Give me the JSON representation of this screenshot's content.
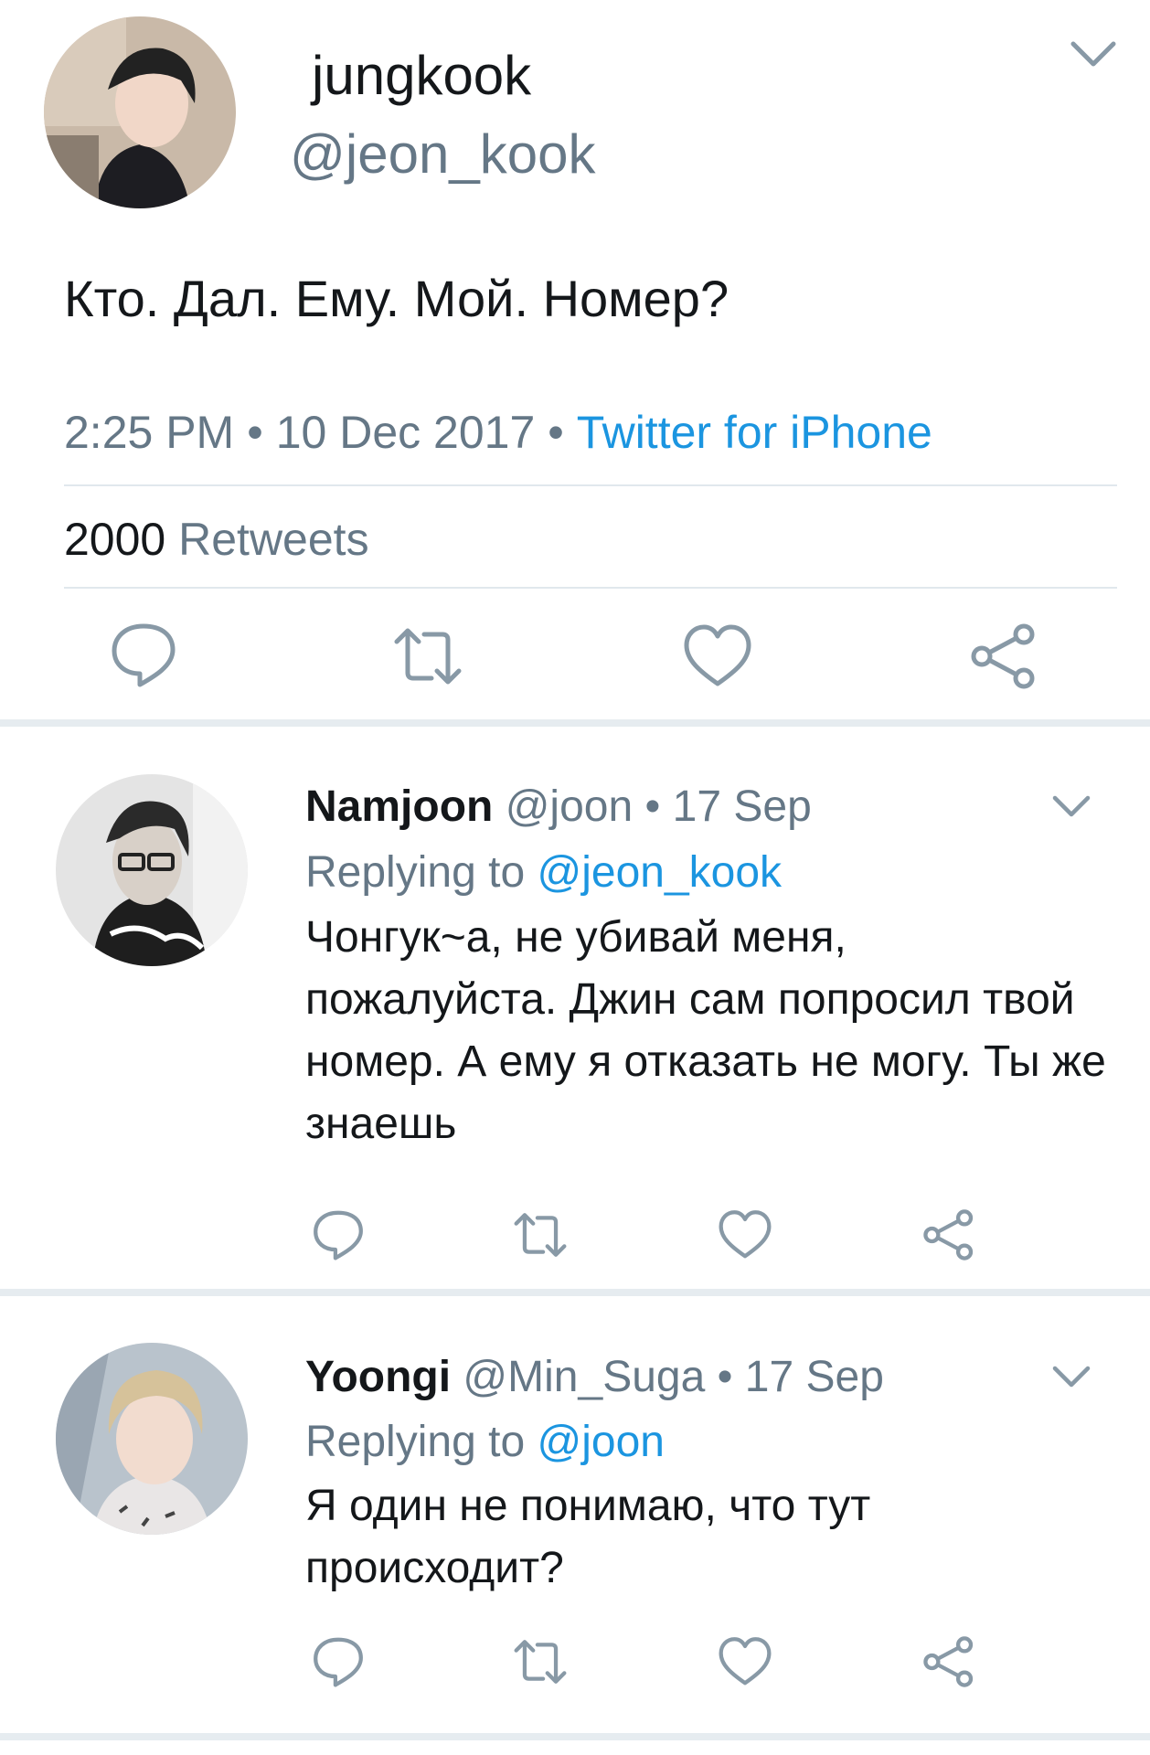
{
  "main_tweet": {
    "name": "jungkook",
    "handle": "@jeon_kook",
    "text": "Кто. Дал. Ему. Мой. Номер?",
    "time": "2:25 PM",
    "date": "10 Dec 2017",
    "source": "Twitter for iPhone",
    "retweet_count": "2000",
    "retweet_label": "Retweets"
  },
  "replies": [
    {
      "name": "Namjoon",
      "handle": "@joon",
      "date": "17 Sep",
      "replying_label": "Replying to",
      "replying_to": "@jeon_kook",
      "text": "Чонгук~а, не убивай меня, пожалуйста. Джин сам попросил твой номер. А ему я отказать не могу. Ты же знаешь"
    },
    {
      "name": "Yoongi",
      "handle": "@Min_Suga",
      "date": "17 Sep",
      "replying_label": "Replying to",
      "replying_to": "@joon",
      "text": "Я один не понимаю, что тут происходит?"
    }
  ],
  "icons": [
    "chevron-down-icon",
    "reply-icon",
    "retweet-icon",
    "like-icon",
    "share-icon"
  ],
  "colors": {
    "link": "#1b95e0",
    "secondary": "#657786",
    "icon": "#8899a6",
    "divider": "#e1e8ed"
  },
  "separator": "•"
}
